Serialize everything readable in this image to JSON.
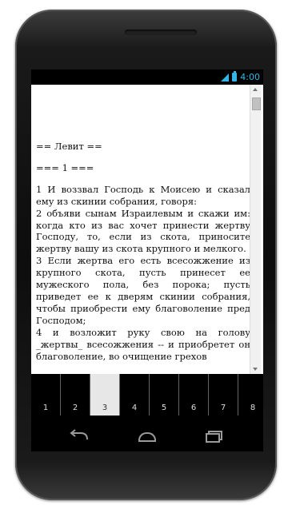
{
  "status_bar": {
    "time": "4:00",
    "icons": [
      "signal-icon",
      "battery-icon"
    ],
    "accent_color": "#33b5e5"
  },
  "document": {
    "heading1": "== Левит ==",
    "heading2": "=== 1 ===",
    "verses": [
      "1 И воззвал Господь к Моисею и сказал ему из скинии собрания, говоря:",
      "2 объяви сынам Израилевым и скажи им: когда кто из вас хочет принести жертву Господу, то, если из скота, приносите жертву вашу из скота крупного и мелкого.",
      "3 Если жертва его есть всесожжение из крупного скота, пусть принесет ее мужеского пола, без порока; пусть приведет ее к дверям скинии собрания, чтобы приобрести ему благоволение пред Господом;",
      "4 и возложит руку свою на голову _жертвы_ всесожжения -- и приобретет он благоволение, во очищение грехов"
    ]
  },
  "tabs": {
    "labels": [
      "1",
      "2",
      "3",
      "4",
      "5",
      "6",
      "7",
      "8"
    ],
    "selected": "3"
  },
  "nav_bar": {
    "icons": [
      "back-icon",
      "home-icon",
      "recent-apps-icon"
    ]
  }
}
